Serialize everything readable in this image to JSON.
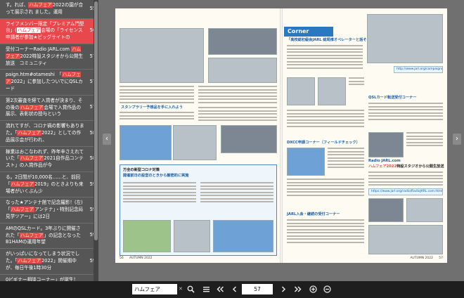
{
  "sidebar": {
    "results": [
      {
        "pre": "す。れば、",
        "hl": "ハムフェア",
        "post": "2022の園が合って展示され ました。運用",
        "page": "55",
        "active": false
      },
      {
        "pre": "ライフメンバー限定「プレミアム門型台」(",
        "hl": "ハムフェア",
        "post": "会場の「ライセンス申請者が参加★ビッグサイトの",
        "page": "56",
        "active": true
      },
      {
        "pre": "受付コーナーRadio JARL.com ",
        "hl": "ハムフェア",
        "post": "2022特設スタジオから公開生放送　コミュニティ",
        "page": "57",
        "active": false
      },
      {
        "pre": "paign.htm#otameshi　「",
        "hl": "ハムフェア",
        "post": "2022」に参加したついでにQSLカード",
        "page": "57",
        "active": false
      },
      {
        "pre": "第2次審査を経て入賞者が決まり、その後の",
        "hl": "ハムフェア",
        "post": "会場で入賞作品の展示、表彰状の授与という",
        "page": "57",
        "active": false
      },
      {
        "pre": "流れてすが、コロナ禍の影響もありまた。「",
        "hl": "ハムフェア",
        "post": "2022」としての作品展示会が行われ、",
        "page": "58",
        "active": false
      },
      {
        "pre": "稼業はおこなわれず、昨年辛さえれていた「",
        "hl": "ハムフェア",
        "post": "2021自作品コンテスト」の入賞作品が今",
        "page": "58",
        "active": false
      },
      {
        "pre": "る。2日間が10,000名……と、前回「",
        "hl": "ハムフェア",
        "post": "2019」のときよりも来場者がいくぶん少",
        "page": "59",
        "active": false
      },
      {
        "pre": "なった★アンテナ館で記念撮影！(左)「",
        "hl": "ハムフェア",
        "post": "アンテナ」・特別記念局見学ツアー」には2日",
        "page": "59",
        "active": false
      },
      {
        "pre": "AMのQSLカード。3年ぶりに開催された「",
        "hl": "ハムフェア",
        "post": "」の記念となったB1HAMの運用年望",
        "page": "59",
        "active": false
      },
      {
        "pre": "がいっぱいになってしまう状況でした。「",
        "hl": "ハムフェア",
        "post": "2022」開催期中が、毎日午後1時30分",
        "page": "59",
        "active": false
      },
      {
        "pre": "0ビギナー相談コーナー」が誕生！",
        "hl": "",
        "post": "",
        "page": "",
        "active": false
      }
    ]
  },
  "pages": {
    "left": {
      "heading_1": "スタンプラリー予想品を手に入れよう",
      "heading_2": "万全の新型コロナ対策",
      "heading_2b": "開催前日の設営のときから厳密的に実施",
      "footer_page": "56",
      "footer_label": "AUTUMN 2022"
    },
    "right": {
      "corner_label": "Corner",
      "h_1": "「高校総初級会JARL 総局推オペレーターと話そう！」コーナー",
      "h_2": "QSLカード転送受付コーナー",
      "h_3": "DXCC申請コーナー（フィールドチェック）",
      "h_4": "Radio JARL.com",
      "h_4b": "特設スタジオから公開生放送",
      "h_4b_tag": "ハムフェア2022",
      "h_5": "JARL入会・継続の受付コーナー",
      "url_1": "http://www.jarl.org/campaign/otameshi",
      "url_2": "https://www.jarl.org/radio/RadioJARL.com.html",
      "footer_label": "AUTUMN 2022",
      "footer_page": "57"
    }
  },
  "toolbar": {
    "search_value": "ハムフェア",
    "search_placeholder": "検索",
    "clear_label": "✕",
    "page_value": "57"
  },
  "colors": {
    "accent": "#e8474c",
    "sidebar_bg": "#565656",
    "toolbar_bg": "#1e1e1e",
    "viewer_bg": "#707070",
    "corner_blue": "#2a78c2"
  }
}
